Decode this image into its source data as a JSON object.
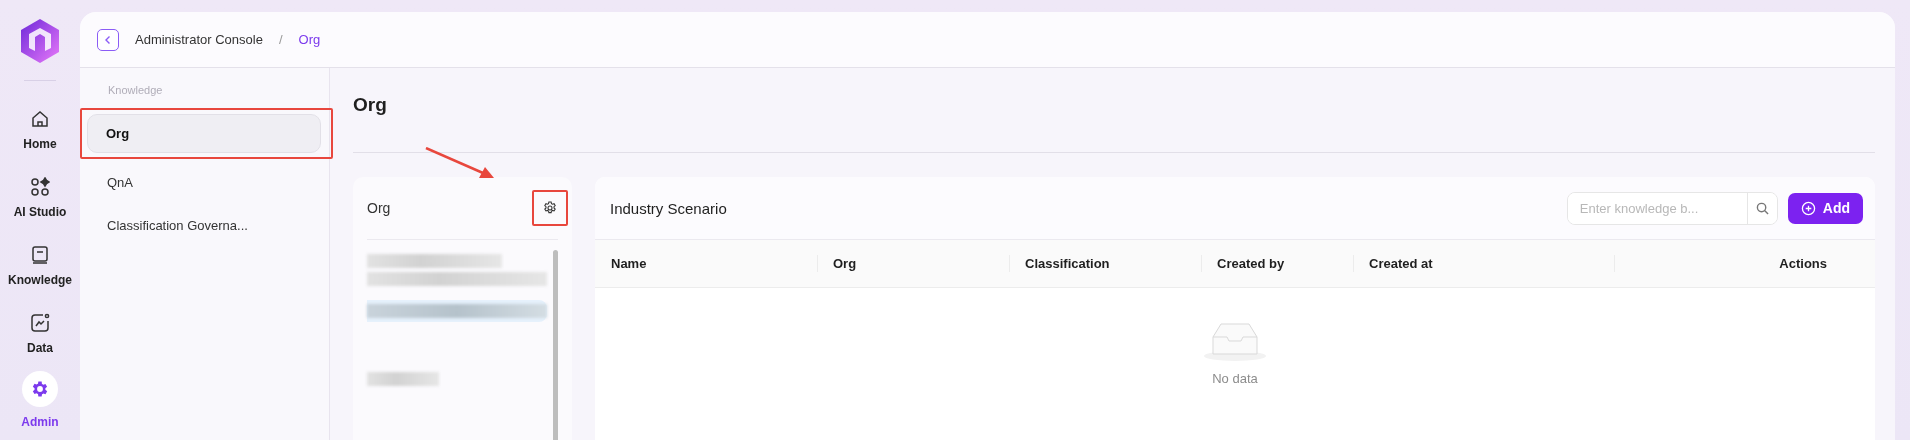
{
  "nav": [
    {
      "label": "Home",
      "selected": false
    },
    {
      "label": "AI Studio",
      "selected": false
    },
    {
      "label": "Knowledge",
      "selected": false
    },
    {
      "label": "Data",
      "selected": false
    },
    {
      "label": "Admin",
      "selected": true
    }
  ],
  "breadcrumb": [
    "Administrator Console",
    "Org"
  ],
  "breadcrumb_separator": "/",
  "sidebar": {
    "section": "Knowledge",
    "items": [
      {
        "label": "Org",
        "selected": true,
        "highlighted": true
      },
      {
        "label": "QnA",
        "selected": false,
        "highlighted": false
      },
      {
        "label": "Classification Governa...",
        "selected": false,
        "highlighted": false
      }
    ]
  },
  "page_title": "Org",
  "org_panel": {
    "title": "Org",
    "settings_highlighted": true,
    "items": [
      {
        "selected": false
      },
      {
        "selected": true
      },
      {
        "selected": false
      }
    ]
  },
  "scenario_panel": {
    "title": "Industry Scenario",
    "search": {
      "placeholder": "Enter knowledge b..."
    },
    "add_button": "Add",
    "table": {
      "columns": [
        "Name",
        "Org",
        "Classification",
        "Created by",
        "Created at",
        "Actions"
      ],
      "empty_text": "No data"
    }
  }
}
